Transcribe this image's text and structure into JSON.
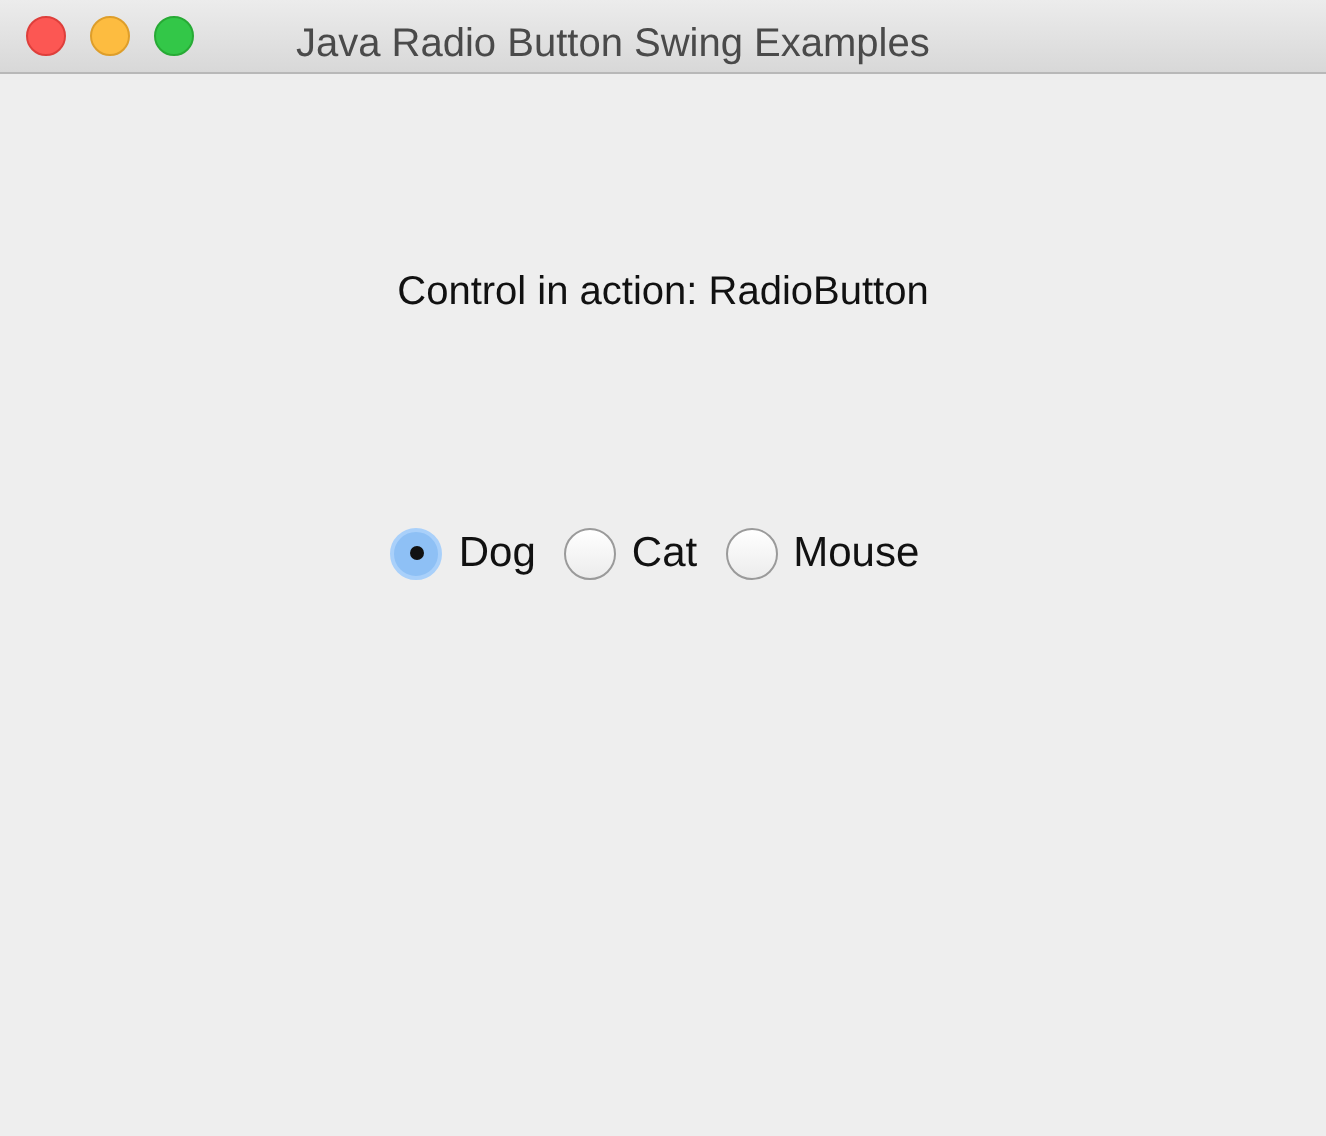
{
  "window": {
    "title": "Java Radio Button Swing Examples"
  },
  "label": "Control in action: RadioButton",
  "radios": [
    {
      "label": "Dog",
      "selected": true
    },
    {
      "label": "Cat",
      "selected": false
    },
    {
      "label": "Mouse",
      "selected": false
    }
  ]
}
